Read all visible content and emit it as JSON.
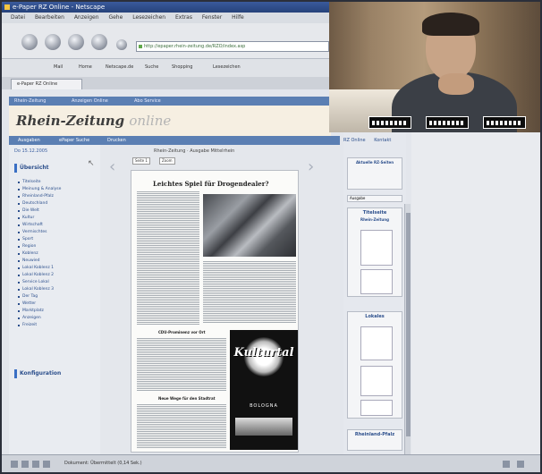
{
  "window": {
    "title": "e-Paper RZ Online - Netscape"
  },
  "menu": {
    "items": [
      "Datei",
      "Bearbeiten",
      "Anzeigen",
      "Gehe",
      "Lesezeichen",
      "Extras",
      "Fenster",
      "Hilfe"
    ]
  },
  "nav": {
    "url": "http://epaper.rhein-zeitung.de/RZO/index.asp"
  },
  "bookmarks": {
    "items": [
      "Mail",
      "Home",
      "Netscape.de",
      "Suche",
      "Shopping",
      "Lesezeichen"
    ]
  },
  "tabs": {
    "active_label": "e-Paper RZ Online"
  },
  "site": {
    "topbar": [
      "Rhein-Zeitung",
      "Anzeigen Online",
      "Abo Service"
    ],
    "logo_main": "Rhein-Zeitung",
    "logo_sub": "online",
    "navstrip": [
      "Ausgaben",
      "ePaper Suche",
      "Drucken"
    ],
    "date": "Do 15.12.2005",
    "sections": {
      "overview": "Übersicht",
      "config": "Konfiguration"
    },
    "links": [
      "Titelseite",
      "Meinung & Analyse",
      "Rheinland-Pfalz",
      "Deutschland",
      "Die Welt",
      "Kultur",
      "Wirtschaft",
      "Vermischtes",
      "Sport",
      "Region",
      "Koblenz",
      "Neuwied",
      "Lokal Koblenz 1",
      "Lokal Koblenz 2",
      "Service Lokal",
      "Lokal Koblenz 3",
      "Der Tag",
      "Wetter",
      "Marktplatz",
      "Anzeigen",
      "Freizeit"
    ]
  },
  "viewer": {
    "page_title": "Rhein-Zeitung · Ausgabe Mittelrhein",
    "controls": [
      "Seite 1",
      "Zoom"
    ],
    "headline": "Leichtes Spiel für Drogendealer?",
    "poster_text": "Kulturtal",
    "poster_city": "BOLOGNA",
    "small_heads": [
      "CDU-Prominenz vor Ort",
      "Neue Wege für den Stadtrat"
    ]
  },
  "right": {
    "tabs": [
      "RZ Online",
      "Kontakt"
    ],
    "box_label": "Aktuelle RZ-Seiten",
    "select_label": "Ausgabe",
    "titelseite": "Titelseite",
    "region": "Rhein-Zeitung",
    "lokal": "Lokales",
    "bottom": "Rheinland-Pfalz"
  },
  "status": {
    "text": "Dokument: Übermittelt (0,14 Sek.)"
  },
  "colors": {
    "accent": "#5b7fb3",
    "link": "#2c4f8c"
  }
}
